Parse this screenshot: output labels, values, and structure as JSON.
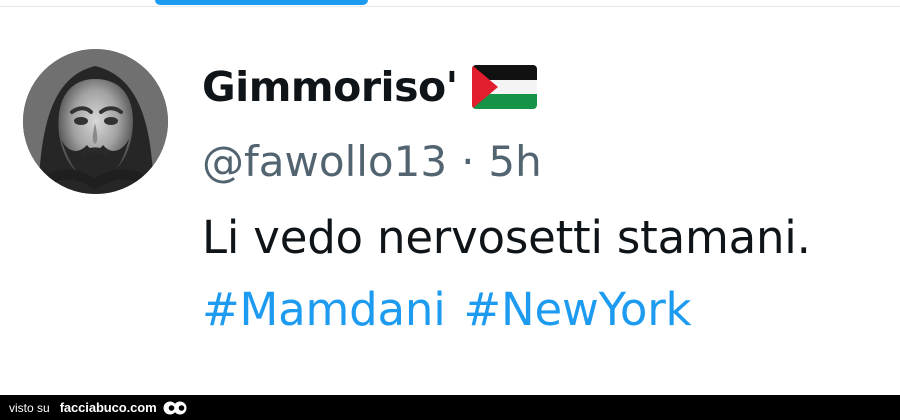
{
  "tweet": {
    "display_name": "Gimmoriso'",
    "handle": "@fawollo13",
    "separator": "·",
    "time": "5h",
    "text": "Li vedo nervosetti stamani.",
    "hashtags": [
      "#Mamdani",
      "#NewYork"
    ]
  },
  "icons": {
    "avatar": "bearded-man-avatar",
    "flag": "palestine-flag-emoji"
  },
  "footer": {
    "prefix": "visto su",
    "site": "facciabuco.com",
    "logo": "eyes-logo-icon"
  },
  "colors": {
    "text": "#0f1419",
    "secondary_text": "#536471",
    "hashtag": "#1d9bf0",
    "top_tab": "#1d9bf0",
    "footer_background": "#000000"
  }
}
